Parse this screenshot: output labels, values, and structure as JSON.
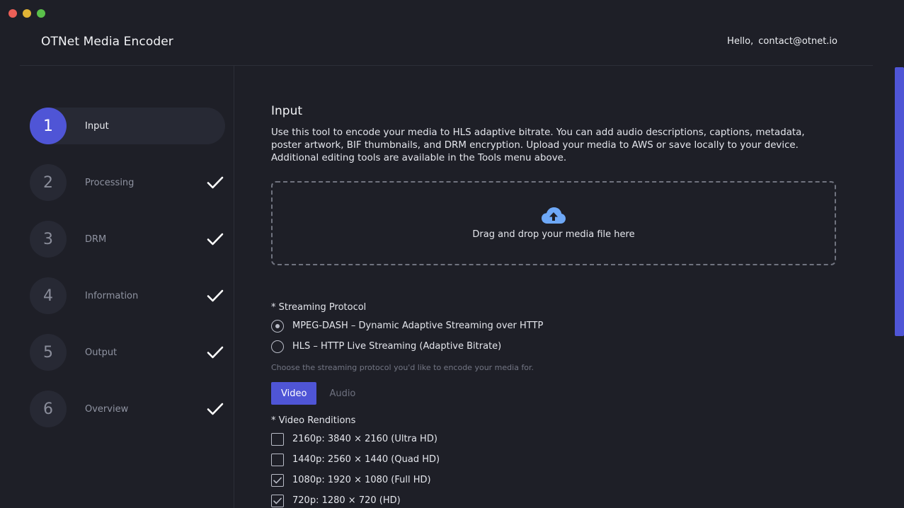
{
  "app": {
    "title": "OTNet Media Encoder",
    "greeting": "Hello,",
    "user_email": "contact@otnet.io"
  },
  "steps": [
    {
      "number": "1",
      "label": "Input",
      "active": true,
      "completed": false
    },
    {
      "number": "2",
      "label": "Processing",
      "active": false,
      "completed": true
    },
    {
      "number": "3",
      "label": "DRM",
      "active": false,
      "completed": true
    },
    {
      "number": "4",
      "label": "Information",
      "active": false,
      "completed": true
    },
    {
      "number": "5",
      "label": "Output",
      "active": false,
      "completed": true
    },
    {
      "number": "6",
      "label": "Overview",
      "active": false,
      "completed": true
    }
  ],
  "main": {
    "title": "Input",
    "description": "Use this tool to encode your media to HLS adaptive bitrate. You can add audio descriptions, captions, metadata, poster artwork, BIF thumbnails, and DRM encryption. Upload your media to AWS or save locally to your device. Additional editing tools are available in the Tools menu above.",
    "dropzone_text": "Drag and drop your media file here",
    "protocol": {
      "label": "* Streaming Protocol",
      "options": [
        {
          "label": "MPEG-DASH – Dynamic Adaptive Streaming over HTTP",
          "selected": true
        },
        {
          "label": "HLS – HTTP Live Streaming (Adaptive Bitrate)",
          "selected": false
        }
      ],
      "hint": "Choose the streaming protocol you'd like to encode your media for."
    },
    "tabs": [
      {
        "label": "Video",
        "active": true
      },
      {
        "label": "Audio",
        "active": false
      }
    ],
    "renditions": {
      "label": "* Video Renditions",
      "options": [
        {
          "label": "2160p: 3840 × 2160 (Ultra HD)",
          "checked": false
        },
        {
          "label": "1440p: 2560 × 1440 (Quad HD)",
          "checked": false
        },
        {
          "label": "1080p: 1920 × 1080 (Full HD)",
          "checked": true
        },
        {
          "label": "720p: 1280 × 720 (HD)",
          "checked": true
        }
      ]
    }
  },
  "colors": {
    "background": "#1e1f27",
    "accent": "#4f55d6",
    "upload_icon": "#6ea8f7"
  }
}
